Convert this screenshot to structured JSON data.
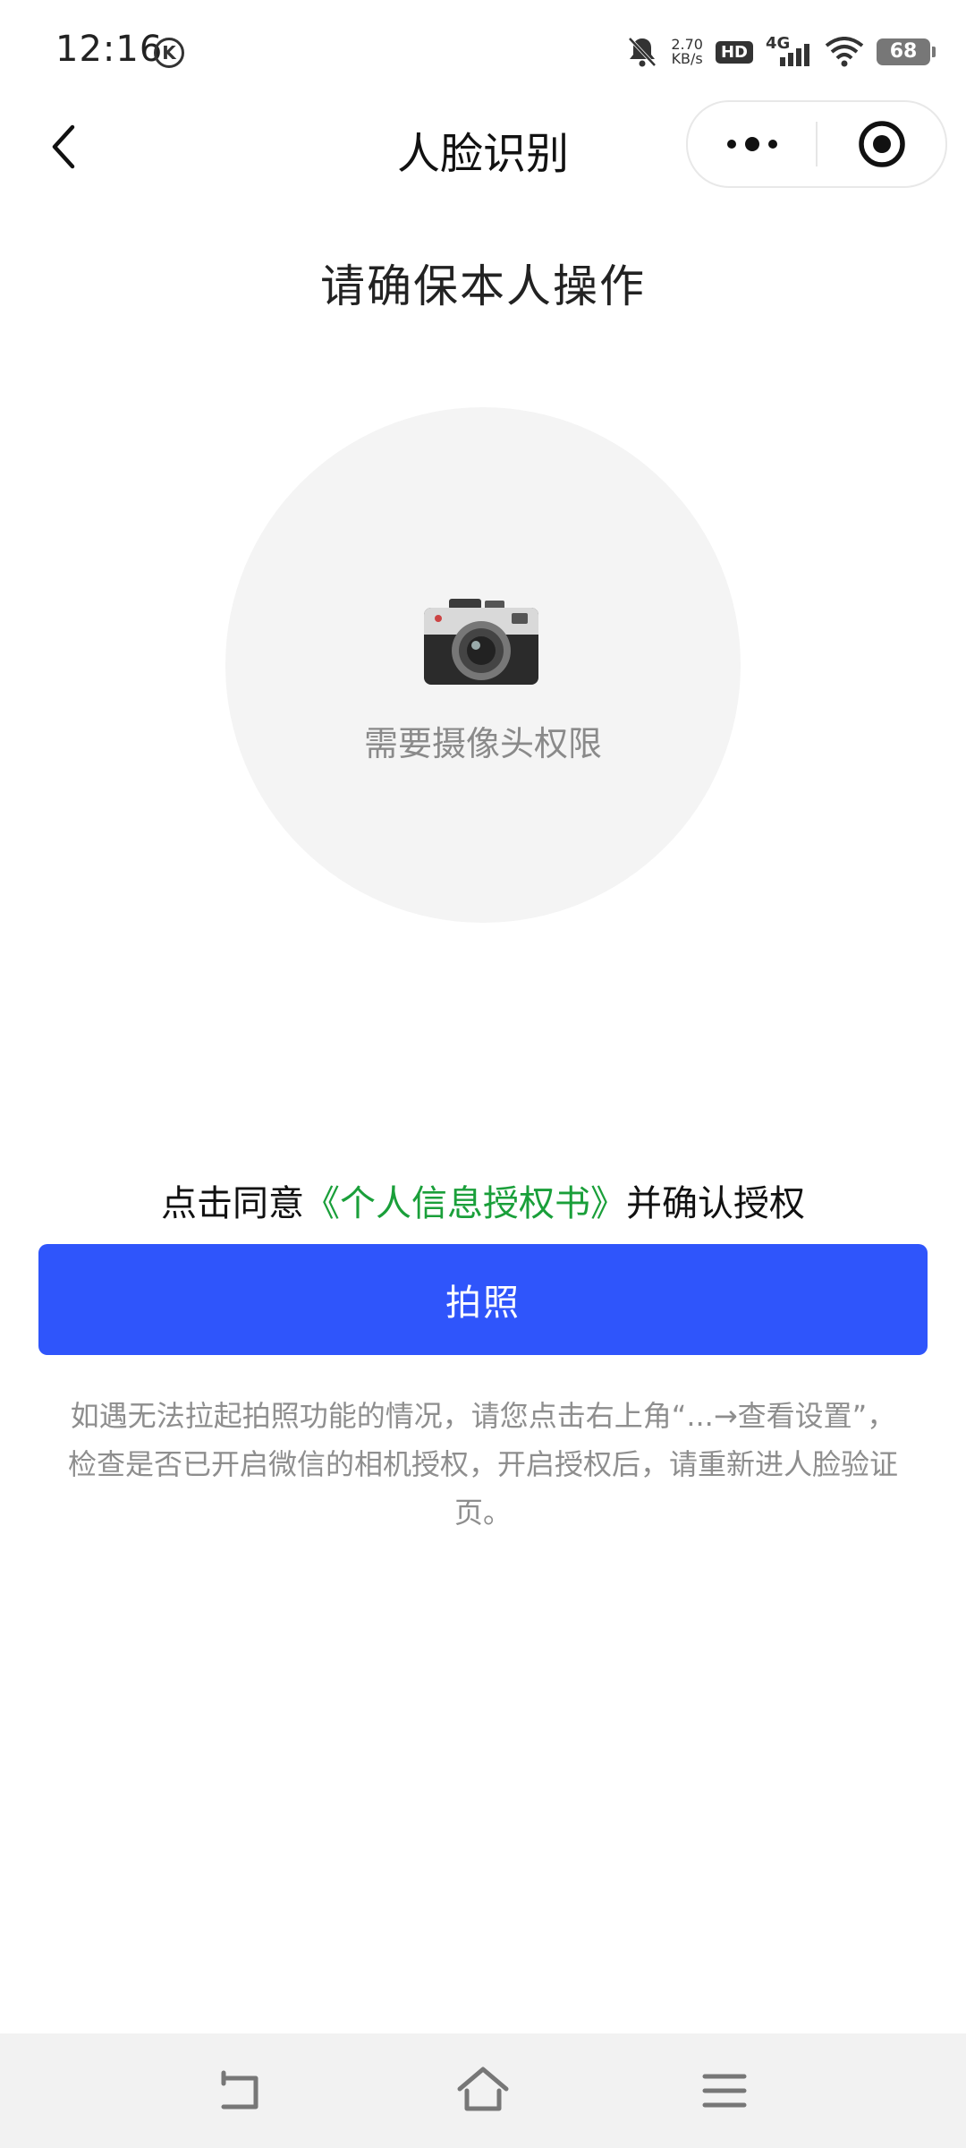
{
  "status_bar": {
    "time": "12:16",
    "k_badge": "K",
    "speed_value": "2.70",
    "speed_unit": "KB/s",
    "hd_label": "HD",
    "network_label": "4G",
    "battery_level": "68"
  },
  "nav": {
    "title": "人脸识别"
  },
  "main": {
    "headline": "请确保本人操作",
    "camera_hint": "需要摄像头权限",
    "agree_prefix": "点击同意",
    "agree_link": "《个人信息授权书》",
    "agree_suffix": "并确认授权",
    "photo_button": "拍照",
    "tip": "如遇无法拉起拍照功能的情况，请您点击右上角“...→查看设置”，检查是否已开启微信的相机授权，开启授权后，请重新进人脸验证页。"
  },
  "colors": {
    "primary_button": "#2f55fb",
    "link_green": "#1a9f3a",
    "circle_bg": "#f4f4f4"
  },
  "icons": [
    "back-icon",
    "more-icon",
    "close-capsule-icon",
    "camera-icon",
    "mute-bell-icon",
    "wifi-icon",
    "sys-back-icon",
    "sys-home-icon",
    "sys-menu-icon"
  ]
}
